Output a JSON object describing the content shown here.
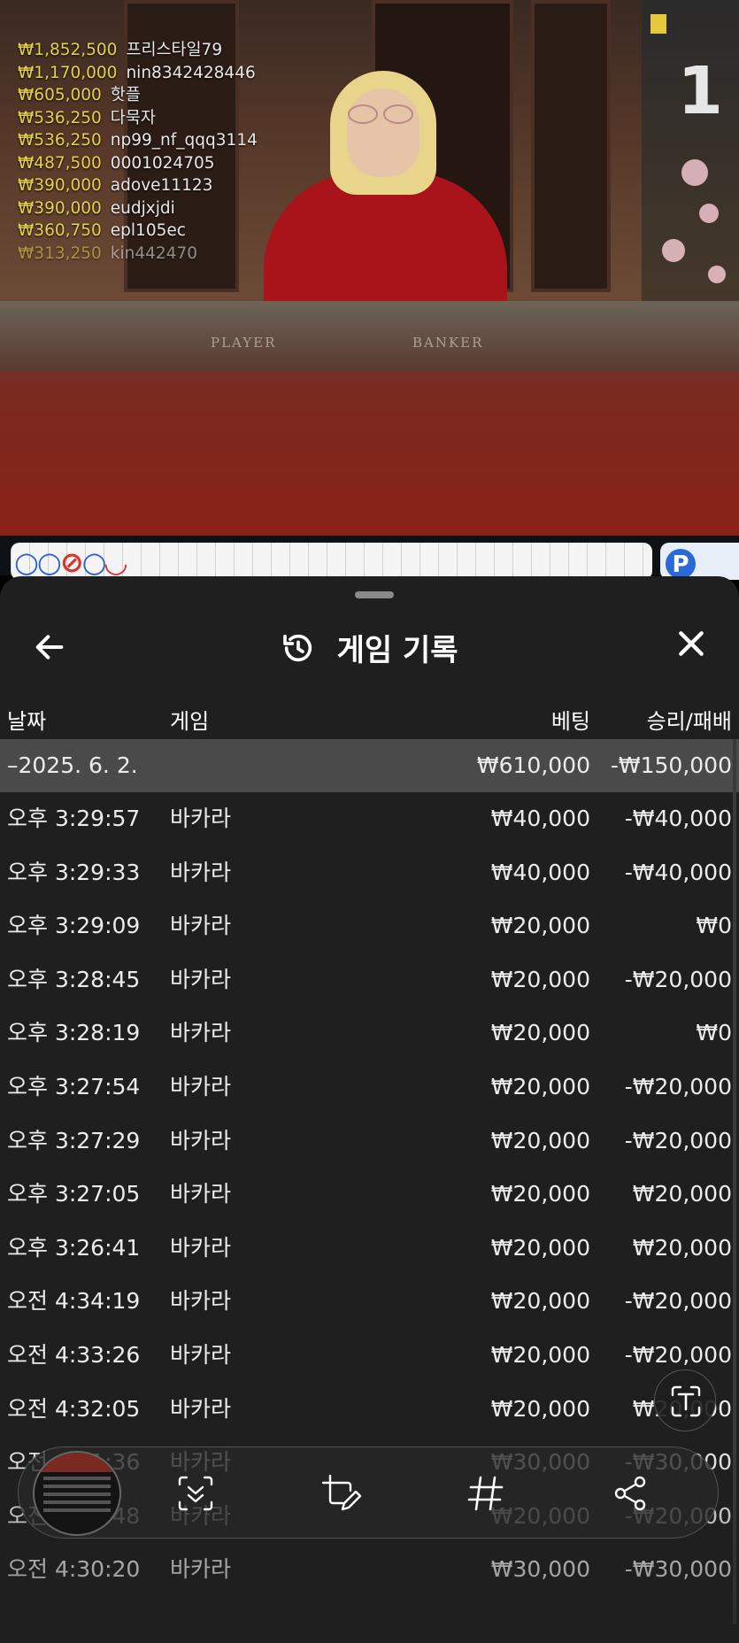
{
  "stream": {
    "round_number": "1",
    "table_labels": {
      "player": "PLAYER",
      "banker": "BANKER"
    },
    "winners": [
      {
        "amount": "₩1,852,500",
        "name": "프리스타일79"
      },
      {
        "amount": "₩1,170,000",
        "name": "nin8342428446"
      },
      {
        "amount": "₩605,000",
        "name": "핫플"
      },
      {
        "amount": "₩536,250",
        "name": "다묵자"
      },
      {
        "amount": "₩536,250",
        "name": "np99_nf_qqq3114"
      },
      {
        "amount": "₩487,500",
        "name": "0001024705"
      },
      {
        "amount": "₩390,000",
        "name": "adove11123"
      },
      {
        "amount": "₩390,000",
        "name": "eudjxjdi"
      },
      {
        "amount": "₩360,750",
        "name": "epl105ec"
      },
      {
        "amount": "₩313,250",
        "name": "kin442470"
      }
    ],
    "road_p_label": "P"
  },
  "sheet": {
    "title": "게임 기록",
    "columns": {
      "date": "날짜",
      "game": "게임",
      "bet": "베팅",
      "winloss": "승리/패배"
    },
    "date_group": {
      "date": "–2025. 6. 2.",
      "bet": "₩610,000",
      "winloss": "-₩150,000"
    },
    "rows": [
      {
        "time": "오후 3:29:57",
        "game": "바카라",
        "bet": "₩40,000",
        "winloss": "-₩40,000"
      },
      {
        "time": "오후 3:29:33",
        "game": "바카라",
        "bet": "₩40,000",
        "winloss": "-₩40,000"
      },
      {
        "time": "오후 3:29:09",
        "game": "바카라",
        "bet": "₩20,000",
        "winloss": "₩0"
      },
      {
        "time": "오후 3:28:45",
        "game": "바카라",
        "bet": "₩20,000",
        "winloss": "-₩20,000"
      },
      {
        "time": "오후 3:28:19",
        "game": "바카라",
        "bet": "₩20,000",
        "winloss": "₩0"
      },
      {
        "time": "오후 3:27:54",
        "game": "바카라",
        "bet": "₩20,000",
        "winloss": "-₩20,000"
      },
      {
        "time": "오후 3:27:29",
        "game": "바카라",
        "bet": "₩20,000",
        "winloss": "-₩20,000"
      },
      {
        "time": "오후 3:27:05",
        "game": "바카라",
        "bet": "₩20,000",
        "winloss": "₩20,000"
      },
      {
        "time": "오후 3:26:41",
        "game": "바카라",
        "bet": "₩20,000",
        "winloss": "₩20,000"
      },
      {
        "time": "오전 4:34:19",
        "game": "바카라",
        "bet": "₩20,000",
        "winloss": "-₩20,000"
      },
      {
        "time": "오전 4:33:26",
        "game": "바카라",
        "bet": "₩20,000",
        "winloss": "-₩20,000"
      },
      {
        "time": "오전 4:32:05",
        "game": "바카라",
        "bet": "₩20,000",
        "winloss": "₩20,000"
      },
      {
        "time": "오전 4:31:36",
        "game": "바카라",
        "bet": "₩30,000",
        "winloss": "-₩30,000"
      },
      {
        "time": "오전 4:30:48",
        "game": "바카라",
        "bet": "₩20,000",
        "winloss": "-₩20,000"
      },
      {
        "time": "오전 4:30:20",
        "game": "바카라",
        "bet": "₩30,000",
        "winloss": "-₩30,000"
      }
    ]
  },
  "overlay": {
    "tools": [
      "scroll-capture-icon",
      "crop-edit-icon",
      "hashtag-icon",
      "share-icon"
    ],
    "text_scan_icon": "text-scan-icon"
  }
}
